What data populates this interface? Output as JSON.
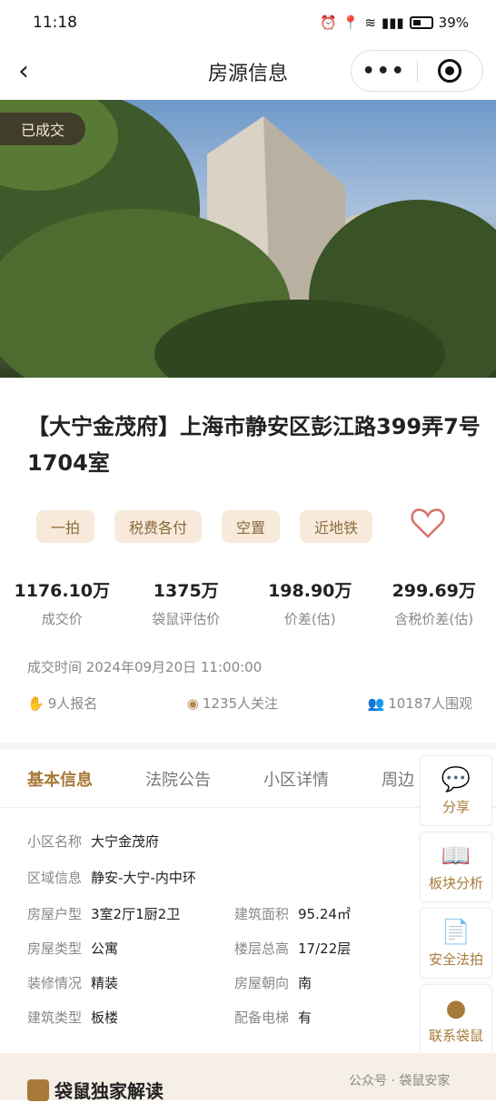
{
  "status": {
    "time": "11:18",
    "battery": "39%"
  },
  "nav": {
    "title": "房源信息",
    "back": "‹",
    "more": "•••"
  },
  "hero": {
    "badge": "已成交"
  },
  "title": "【大宁金茂府】上海市静安区彭江路399弄7号1704室",
  "tags": [
    "一拍",
    "税费各付",
    "空置",
    "近地铁"
  ],
  "stats": [
    {
      "value": "1176.10万",
      "label": "成交价"
    },
    {
      "value": "1375万",
      "label": "袋鼠评估价"
    },
    {
      "value": "198.90万",
      "label": "价差(估)"
    },
    {
      "value": "299.69万",
      "label": "含税价差(估)"
    }
  ],
  "deal_time": "成交时间 2024年09月20日 11:00:00",
  "meta": {
    "signups": "9人报名",
    "followers": "1235人关注",
    "viewers": "10187人围观"
  },
  "tabs": [
    "基本信息",
    "法院公告",
    "小区详情",
    "周边"
  ],
  "info": {
    "community": {
      "k": "小区名称",
      "v": "大宁金茂府"
    },
    "region": {
      "k": "区域信息",
      "v": "静安-大宁-内中环"
    },
    "layout": {
      "k": "房屋户型",
      "v": "3室2厅1厨2卫"
    },
    "area": {
      "k": "建筑面积",
      "v": "95.24㎡"
    },
    "house_type": {
      "k": "房屋类型",
      "v": "公寓"
    },
    "floors": {
      "k": "楼层总高",
      "v": "17/22层"
    },
    "decoration": {
      "k": "装修情况",
      "v": "精装"
    },
    "orientation": {
      "k": "房屋朝向",
      "v": "南"
    },
    "building_type": {
      "k": "建筑类型",
      "v": "板楼"
    },
    "elevator": {
      "k": "配备电梯",
      "v": "有"
    }
  },
  "side": [
    "分享",
    "板块分析",
    "安全法拍",
    "联系袋鼠"
  ],
  "section": {
    "exclusive": "袋鼠独家解读"
  },
  "watermark": "公众号 · 袋鼠安家",
  "colors": {
    "accent": "#a87a3a",
    "tag_bg": "#f7eadb",
    "heart": "#d9726a"
  }
}
